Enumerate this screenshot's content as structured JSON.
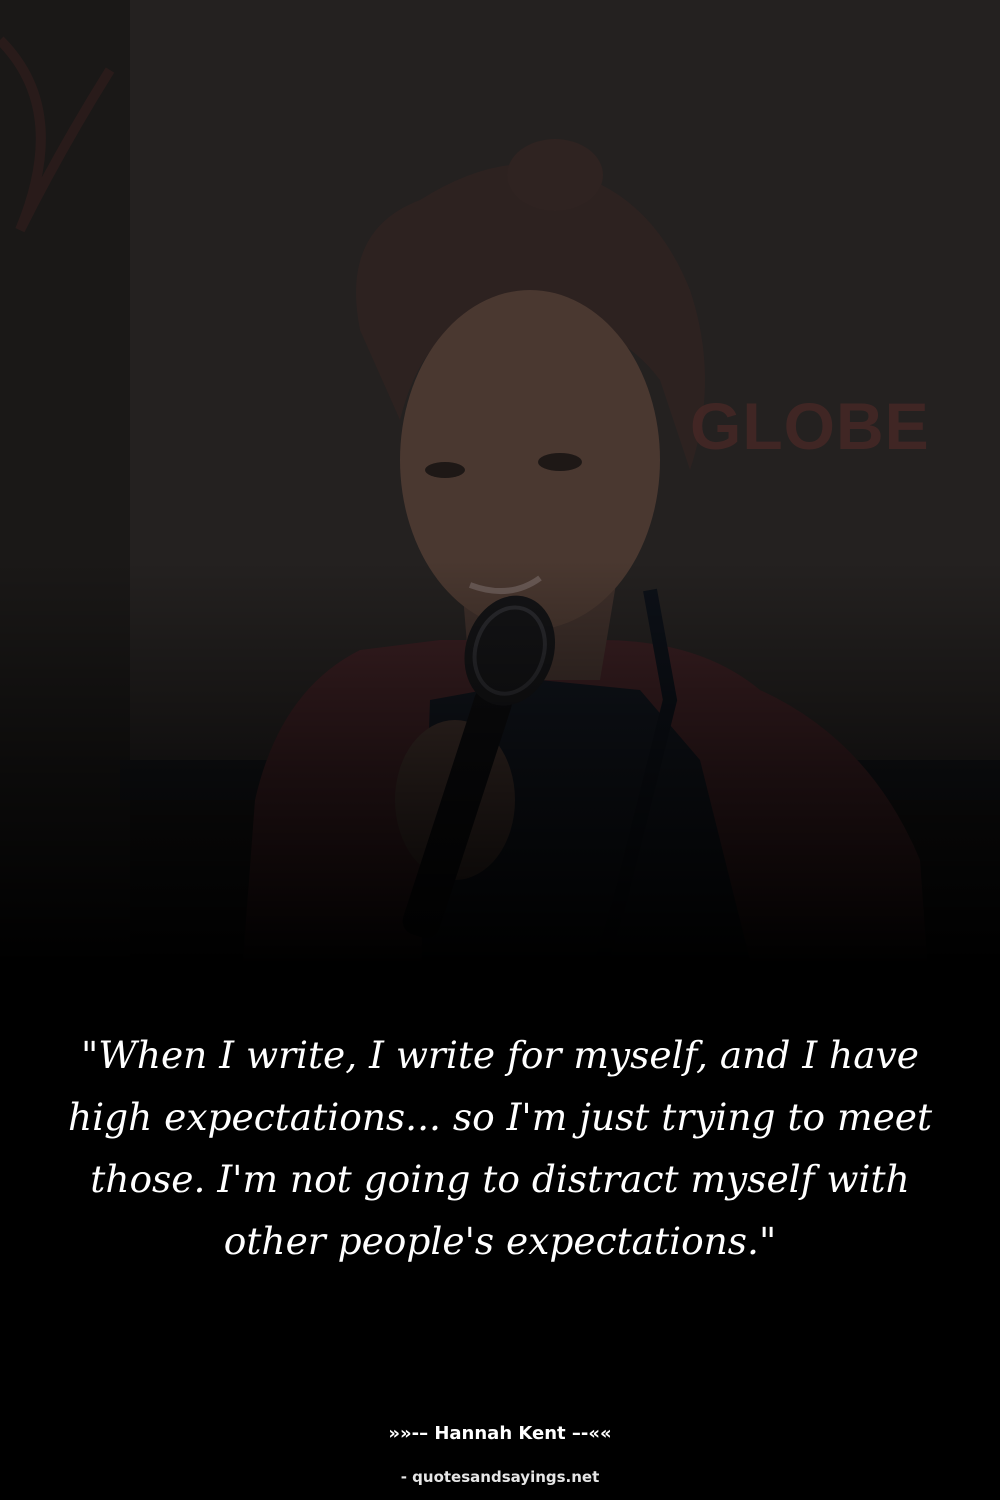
{
  "photo": {
    "sign_text": "GLOBE",
    "colors": {
      "background": "#000000",
      "shirt": "#3a1f22",
      "sign_text": "#4a2826",
      "quote_text": "#ffffff"
    }
  },
  "quote": {
    "text": "\"When I write, I write for myself, and I have high expectations... so I'm just trying to meet those. I'm not going to distract myself with other people's expectations.\""
  },
  "author": {
    "line": "»»-– Hannah Kent –-««"
  },
  "source": {
    "line": "- quotesandsayings.net"
  }
}
